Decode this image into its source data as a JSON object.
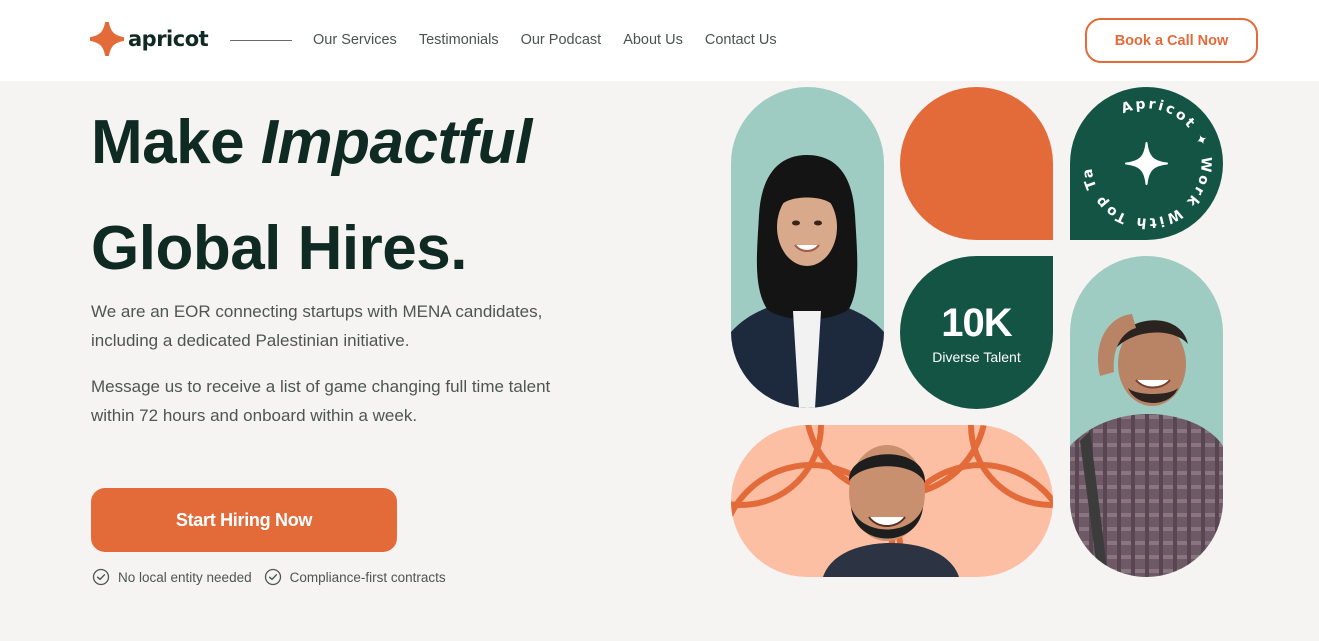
{
  "brand": {
    "name": "apricot",
    "accent": "#e36b3a",
    "dark": "#145445",
    "mint": "#9ecbc2",
    "peach": "#fdbfa4"
  },
  "nav": {
    "items": [
      {
        "label": "Our Services"
      },
      {
        "label": "Testimonials"
      },
      {
        "label": "Our Podcast"
      },
      {
        "label": "About Us"
      },
      {
        "label": "Contact Us"
      }
    ],
    "cta_label": "Book a Call Now"
  },
  "hero": {
    "title_line1_plain": "Make ",
    "title_line1_italic": "Impactful",
    "title_line2": "Global Hires.",
    "paragraph1": "We are an EOR connecting startups with MENA candidates, including a dedicated Palestinian initiative.",
    "paragraph2": "Message us  to receive a list of game changing full time talent within 72 hours and onboard within a week.",
    "cta_label": "Start Hiring Now",
    "checks": [
      {
        "label": "No local entity needed",
        "icon": "check-circle-icon"
      },
      {
        "label": "Compliance-first contracts",
        "icon": "check-circle-icon"
      }
    ]
  },
  "collage": {
    "badge_text": "Apricot ✦ Work With Top Talent ✦",
    "stat_value": "10K",
    "stat_label": "Diverse Talent"
  }
}
